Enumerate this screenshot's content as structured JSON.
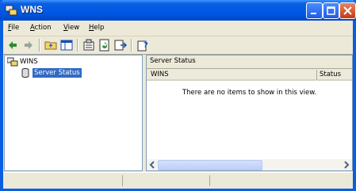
{
  "window": {
    "title": "WNS"
  },
  "menu": [
    {
      "label": "File",
      "key": "F"
    },
    {
      "label": "Action",
      "key": "A"
    },
    {
      "label": "View",
      "key": "V"
    },
    {
      "label": "Help",
      "key": "H"
    }
  ],
  "tree": {
    "root_label": "WINS",
    "child_label": "Server Status"
  },
  "details": {
    "pane_title": "Server Status",
    "columns": [
      "WINS",
      "Status"
    ],
    "empty_message": "There are no items to show in this view."
  },
  "colors": {
    "titlebar": "#0058e6",
    "selection": "#316ac5",
    "chrome": "#ece9d8"
  },
  "icons": {
    "toolbar": [
      "back-arrow-icon",
      "forward-arrow-icon",
      "up-folder-icon",
      "show-hide-tree-icon",
      "properties-icon",
      "refresh-icon",
      "export-list-icon",
      "help-icon"
    ]
  }
}
